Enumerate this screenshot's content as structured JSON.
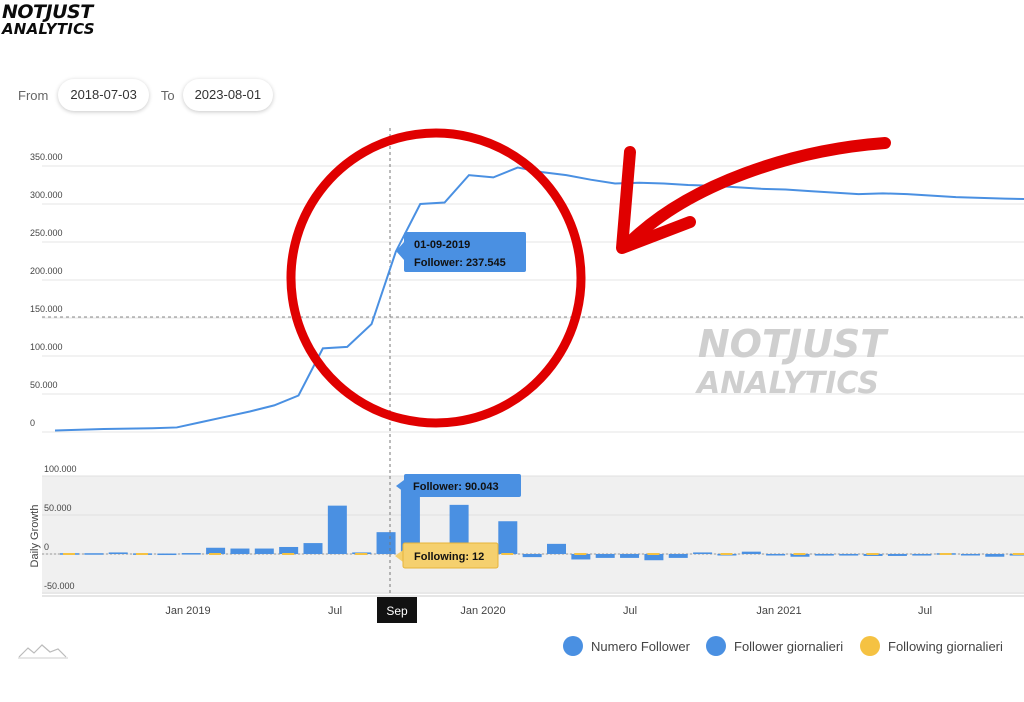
{
  "brand": {
    "line1": "NOTJUST",
    "line2": "ANALYTICS"
  },
  "range": {
    "from_label": "From",
    "from_value": "2018-07-03",
    "to_label": "To",
    "to_value": "2023-08-01"
  },
  "colors": {
    "line": "#4a90e2",
    "bar": "#4a90e2",
    "following": "#f5c242",
    "annotation": "#e00000",
    "tooltip_follow": "#f5d06e"
  },
  "chart_data": [
    {
      "type": "line",
      "series": [
        {
          "name": "Numero Follower",
          "x": [
            "2018-07",
            "2018-08",
            "2018-09",
            "2018-10",
            "2018-11",
            "2018-12",
            "2019-01",
            "2019-02",
            "2019-03",
            "2019-04",
            "2019-05",
            "2019-06",
            "2019-07",
            "2019-08",
            "2019-09",
            "2019-10",
            "2019-11",
            "2019-12",
            "2020-01",
            "2020-02",
            "2020-03",
            "2020-04",
            "2020-05",
            "2020-06",
            "2020-07",
            "2020-08",
            "2020-09",
            "2020-10",
            "2020-11",
            "2020-12",
            "2021-01",
            "2021-02",
            "2021-03",
            "2021-04",
            "2021-05",
            "2021-06",
            "2021-07",
            "2021-08",
            "2021-09",
            "2021-10"
          ],
          "values": [
            2000,
            3000,
            4000,
            4500,
            5000,
            6000,
            13000,
            20000,
            27000,
            35000,
            48000,
            110000,
            112000,
            142000,
            237545,
            300000,
            302000,
            338000,
            335000,
            348000,
            342000,
            338000,
            332000,
            327000,
            328000,
            327000,
            325000,
            324000,
            322000,
            320000,
            319000,
            317000,
            315000,
            313000,
            314000,
            313000,
            311000,
            309000,
            308000,
            307000
          ]
        }
      ],
      "yticks": [
        "0",
        "50.000",
        "100.000",
        "150.000",
        "200.000",
        "250.000",
        "300.000",
        "350.000"
      ],
      "ylim": [
        0,
        350000
      ],
      "tooltip": {
        "date": "01-09-2019",
        "text": "Follower: 237.545"
      }
    },
    {
      "type": "bar",
      "ylabel": "Daily Growth",
      "x": [
        "2018-07",
        "2018-08",
        "2018-09",
        "2018-10",
        "2018-11",
        "2018-12",
        "2019-01",
        "2019-02",
        "2019-03",
        "2019-04",
        "2019-05",
        "2019-06",
        "2019-07",
        "2019-08",
        "2019-09",
        "2019-10",
        "2019-11",
        "2019-12",
        "2020-01",
        "2020-02",
        "2020-03",
        "2020-04",
        "2020-05",
        "2020-06",
        "2020-07",
        "2020-08",
        "2020-09",
        "2020-10",
        "2020-11",
        "2020-12",
        "2021-01",
        "2021-02",
        "2021-03",
        "2021-04",
        "2021-05",
        "2021-06",
        "2021-07",
        "2021-08",
        "2021-09",
        "2021-10"
      ],
      "series": [
        {
          "name": "Follower giornalieri",
          "values": [
            1000,
            1000,
            2000,
            800,
            600,
            1200,
            8000,
            7000,
            7000,
            9000,
            14000,
            62000,
            2000,
            28000,
            90043,
            1000,
            63000,
            2000,
            42000,
            -4000,
            13000,
            -7000,
            -5000,
            -5000,
            -8000,
            -5000,
            2000,
            -1500,
            3000,
            -1000,
            -3500,
            -2000,
            -2000,
            -2500,
            -2500,
            -2000,
            1000,
            -1500,
            -3500,
            -2000
          ]
        },
        {
          "name": "Following giornalieri",
          "values": [
            0,
            0,
            0,
            0,
            0,
            0,
            0,
            0,
            0,
            0,
            0,
            0,
            0,
            0,
            12,
            0,
            0,
            0,
            0,
            0,
            0,
            0,
            0,
            0,
            0,
            0,
            0,
            0,
            0,
            0,
            0,
            0,
            0,
            0,
            0,
            0,
            0,
            0,
            0,
            0
          ]
        }
      ],
      "yticks": [
        "-50.000",
        "0",
        "50.000",
        "100.000"
      ],
      "ylim": [
        -50000,
        100000
      ],
      "xticks": [
        "Jan 2019",
        "Jul",
        "Sep",
        "Jan 2020",
        "Jul",
        "Jan 2021",
        "Jul"
      ],
      "tooltip_follower": "Follower: 90.043",
      "tooltip_following": "Following: 12"
    }
  ],
  "legend": [
    {
      "label": "Numero Follower"
    },
    {
      "label": "Follower giornalieri"
    },
    {
      "label": "Following giornalieri"
    }
  ],
  "watermark": {
    "line1": "NOTJUST",
    "line2": "ANALYTICS"
  }
}
